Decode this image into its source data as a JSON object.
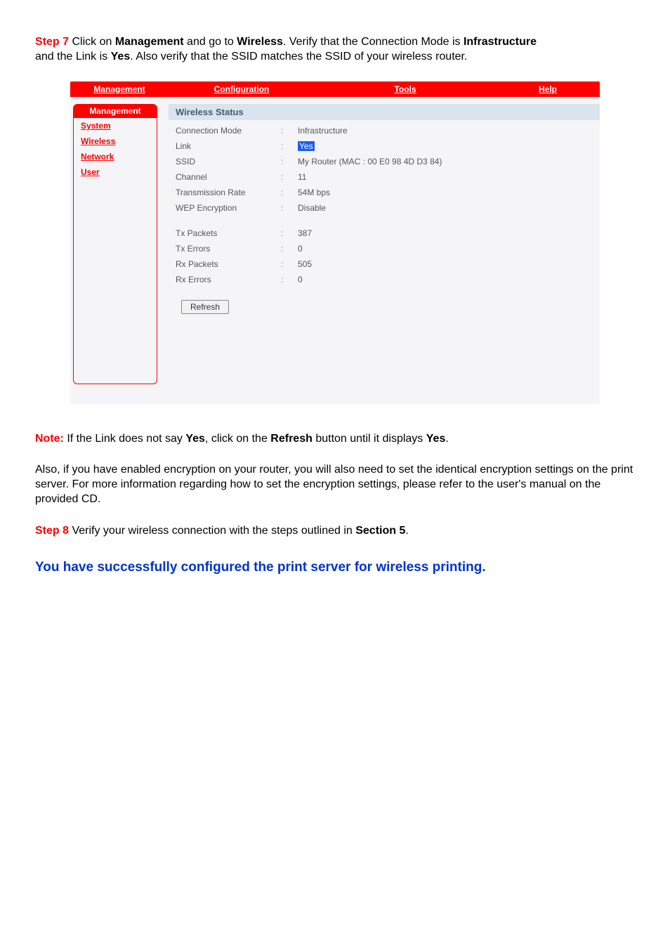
{
  "doc": {
    "step7": {
      "prefix": "Step 7",
      "line1_part1": " Click on ",
      "b1": "Management",
      "line1_part2": " and go to ",
      "b2": "Wireless",
      "line1_part3": ". Verify that the Connection Mode is ",
      "b3": "Infrastructure",
      "line2_part1": "and the Link is ",
      "b4": "Yes",
      "line2_part2": ". Also verify that the SSID matches the SSID of your wireless router."
    },
    "note": {
      "prefix": "Note:",
      "part1": " If the Link does not say ",
      "b1": "Yes",
      "part2": ", click on the ",
      "b2": "Refresh",
      "part3": " button until it displays ",
      "b3": "Yes",
      "part4": "."
    },
    "also": "Also, if you have enabled encryption on your router, you will also need to set the identical encryption settings on the print server. For more information regarding how to set the encryption settings, please refer to the user's manual on the provided CD.",
    "step8": {
      "prefix": "Step 8",
      "part1": " Verify your wireless connection with the steps outlined in ",
      "b1": "Section 5",
      "part2": "."
    },
    "success": "You have successfully configured the print server for wireless printing."
  },
  "ui": {
    "topnav": {
      "n1": "Management",
      "n2": "Configuration",
      "n3": "Tools",
      "n4": "Help"
    },
    "sidebar": {
      "header": "Management",
      "items": [
        "System",
        "Wireless",
        "Network",
        "User"
      ]
    },
    "panel": {
      "header": "Wireless Status",
      "rows": [
        {
          "label": "Connection Mode",
          "value": "Infrastructure"
        },
        {
          "label": "Link",
          "value": "Yes",
          "highlight": true
        },
        {
          "label": "SSID",
          "value": "My Router (MAC : 00 E0 98 4D D3 84)"
        },
        {
          "label": "Channel",
          "value": "11"
        },
        {
          "label": "Transmission Rate",
          "value": "54M bps"
        },
        {
          "label": "WEP Encryption",
          "value": "Disable"
        },
        {
          "label": "Tx Packets",
          "value": "387"
        },
        {
          "label": "Tx Errors",
          "value": "0"
        },
        {
          "label": "Rx Packets",
          "value": "505"
        },
        {
          "label": "Rx Errors",
          "value": "0"
        }
      ],
      "refresh": "Refresh"
    }
  }
}
